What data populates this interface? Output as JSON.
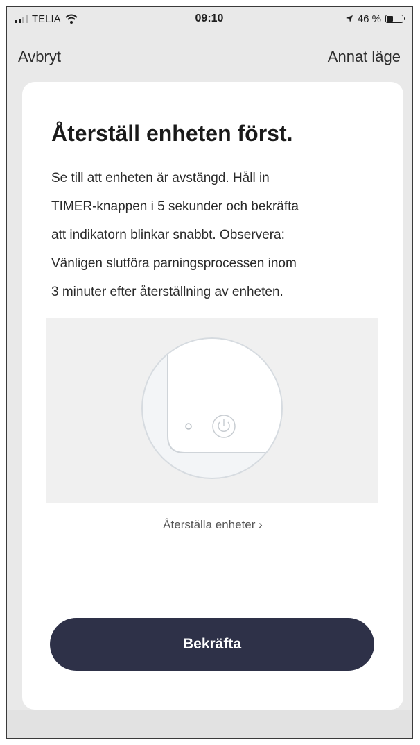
{
  "status_bar": {
    "carrier": "TELIA",
    "time": "09:10",
    "battery_text": "46 %",
    "battery_level": 0.46,
    "signal_bars_active": 2,
    "signal_bars_total": 4
  },
  "nav": {
    "cancel_label": "Avbryt",
    "other_mode_label": "Annat läge"
  },
  "card": {
    "title": "Återställ enheten först.",
    "description_lines": [
      "Se till att enheten är avstängd. Håll in",
      "TIMER-knappen i 5 sekunder och bekräfta",
      "att indikatorn blinkar snabbt. Observera:",
      "Vänligen slutföra parningsprocessen inom",
      "3 minuter efter återställning av enheten."
    ],
    "reset_link_label": "Återställa enheter",
    "reset_link_chevron": "›",
    "confirm_label": "Bekräfta"
  },
  "icons": {
    "signal": "signal-bars-icon",
    "wifi": "wifi-icon",
    "location": "location-arrow-icon",
    "battery": "battery-icon",
    "power": "power-icon",
    "indicator": "indicator-light-icon"
  },
  "colors": {
    "accent_button": "#2e3148",
    "background": "#e9e9e9",
    "card": "#ffffff"
  }
}
